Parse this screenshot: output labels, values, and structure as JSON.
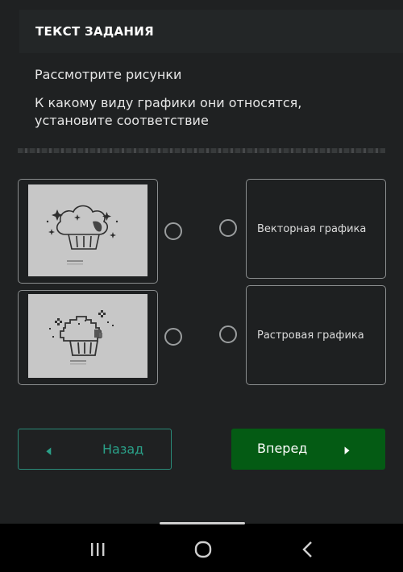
{
  "header": {
    "title": "ТЕКСТ ЗАДАНИЯ"
  },
  "task": {
    "line1": "Рассмотрите рисунки",
    "line2": "К какому виду графики они относятся, установите соответствие"
  },
  "options": [
    {
      "label": "Векторная графика"
    },
    {
      "label": "Растровая графика"
    }
  ],
  "images": [
    {
      "icon": "cupcake-sharp-icon"
    },
    {
      "icon": "cupcake-pixelated-icon"
    }
  ],
  "nav": {
    "back_label": "Назад",
    "next_label": "Вперед",
    "back_border_color": "#2a8a78",
    "next_bg_color": "#045b14"
  },
  "system_nav": {
    "icons": [
      "recent-apps-icon",
      "home-icon",
      "back-icon"
    ]
  }
}
